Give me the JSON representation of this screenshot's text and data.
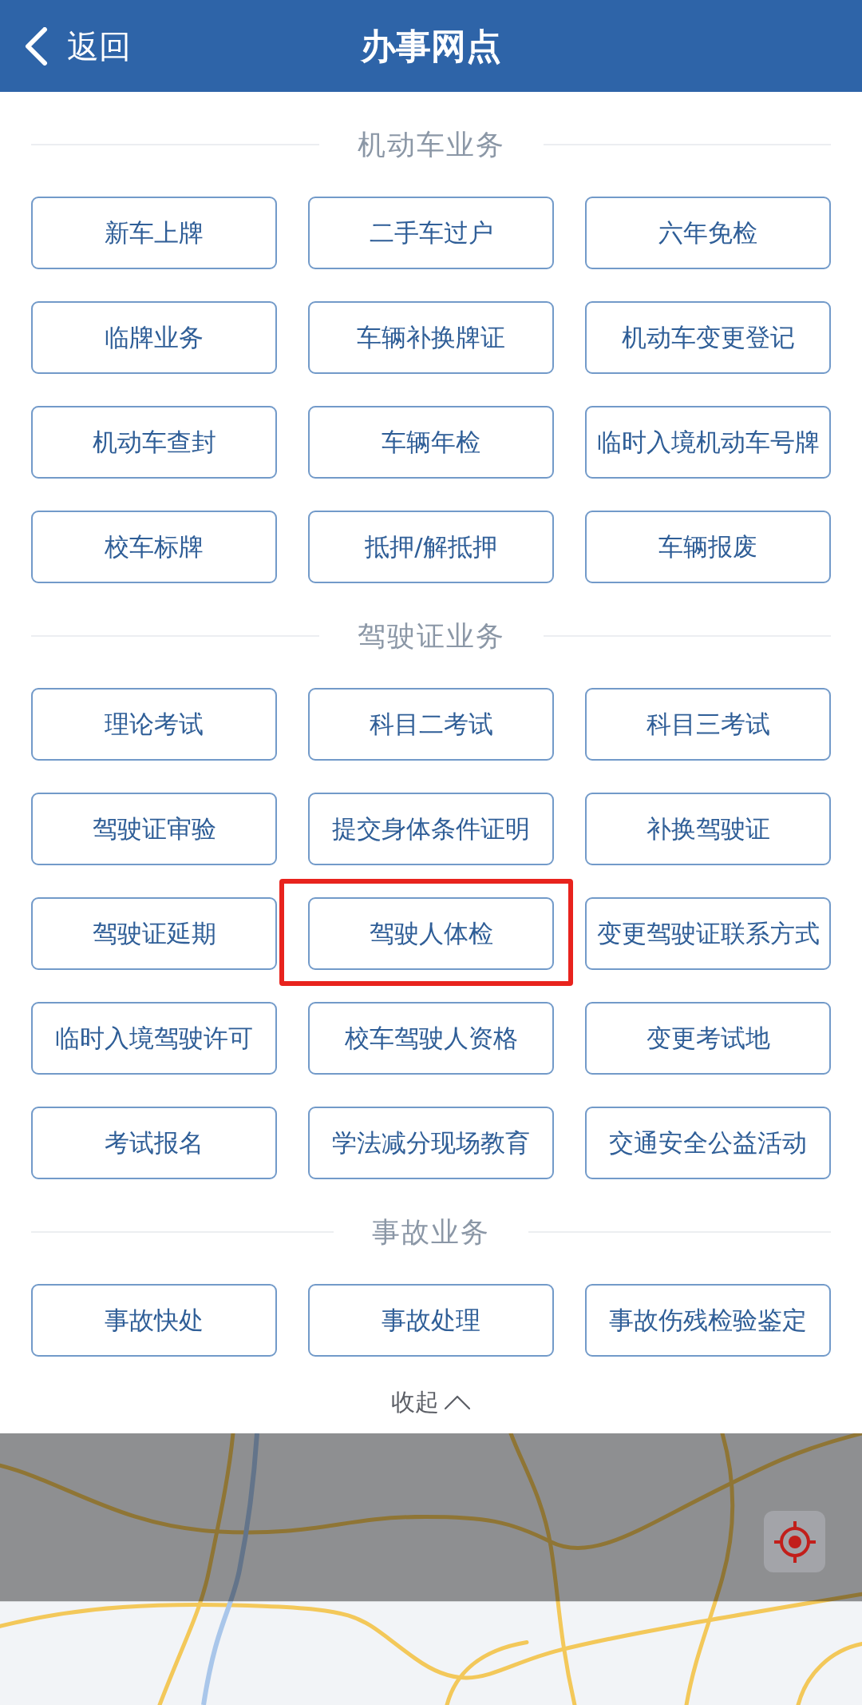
{
  "header": {
    "back_label": "返回",
    "title": "办事网点"
  },
  "sections": [
    {
      "title": "机动车业务",
      "buttons": [
        {
          "label": "新车上牌",
          "highlighted": false
        },
        {
          "label": "二手车过户",
          "highlighted": false
        },
        {
          "label": "六年免检",
          "highlighted": false
        },
        {
          "label": "临牌业务",
          "highlighted": false
        },
        {
          "label": "车辆补换牌证",
          "highlighted": false
        },
        {
          "label": "机动车变更登记",
          "highlighted": false
        },
        {
          "label": "机动车查封",
          "highlighted": false
        },
        {
          "label": "车辆年检",
          "highlighted": false
        },
        {
          "label": "临时入境机动车号牌",
          "highlighted": false
        },
        {
          "label": "校车标牌",
          "highlighted": false
        },
        {
          "label": "抵押/解抵押",
          "highlighted": false
        },
        {
          "label": "车辆报废",
          "highlighted": false
        }
      ]
    },
    {
      "title": "驾驶证业务",
      "buttons": [
        {
          "label": "理论考试",
          "highlighted": false
        },
        {
          "label": "科目二考试",
          "highlighted": false
        },
        {
          "label": "科目三考试",
          "highlighted": false
        },
        {
          "label": "驾驶证审验",
          "highlighted": false
        },
        {
          "label": "提交身体条件证明",
          "highlighted": false
        },
        {
          "label": "补换驾驶证",
          "highlighted": false
        },
        {
          "label": "驾驶证延期",
          "highlighted": false
        },
        {
          "label": "驾驶人体检",
          "highlighted": true
        },
        {
          "label": "变更驾驶证联系方式",
          "highlighted": false
        },
        {
          "label": "临时入境驾驶许可",
          "highlighted": false
        },
        {
          "label": "校车驾驶人资格",
          "highlighted": false
        },
        {
          "label": "变更考试地",
          "highlighted": false
        },
        {
          "label": "考试报名",
          "highlighted": false
        },
        {
          "label": "学法减分现场教育",
          "highlighted": false
        },
        {
          "label": "交通安全公益活动",
          "highlighted": false
        }
      ]
    },
    {
      "title": "事故业务",
      "buttons": [
        {
          "label": "事故快处",
          "highlighted": false
        },
        {
          "label": "事故处理",
          "highlighted": false
        },
        {
          "label": "事故伤残检验鉴定",
          "highlighted": false
        }
      ]
    }
  ],
  "collapse": {
    "label": "收起"
  }
}
